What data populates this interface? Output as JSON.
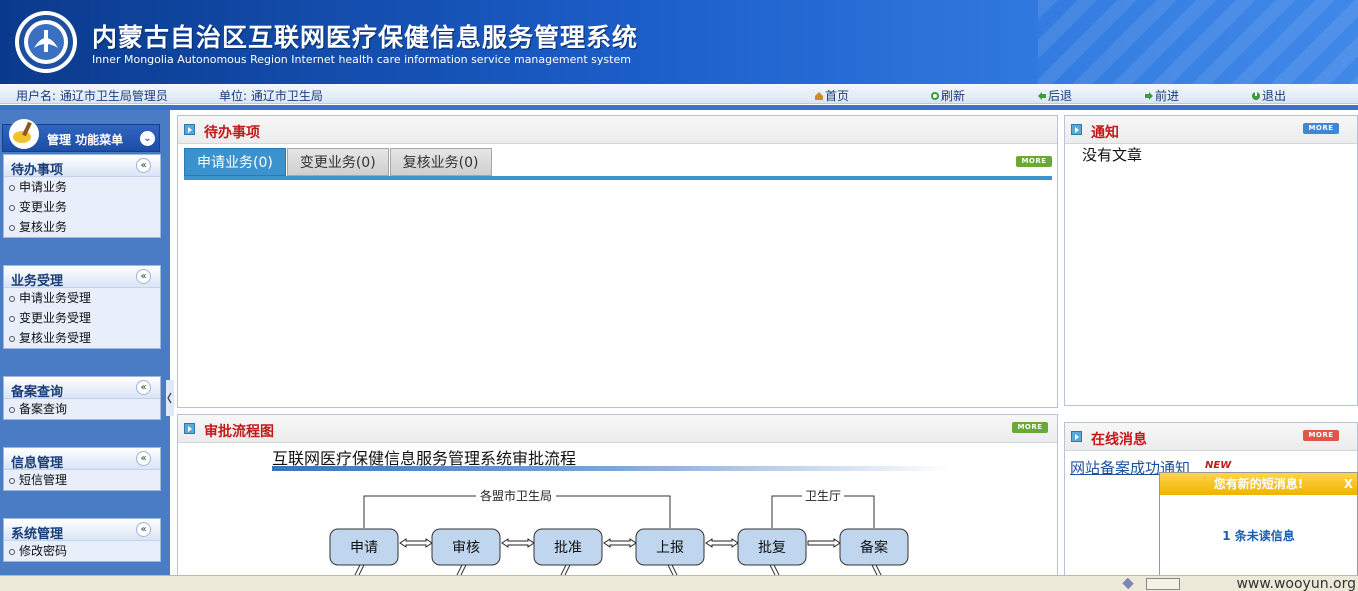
{
  "header": {
    "title_cn": "内蒙古自治区互联网医疗保健信息服务管理系统",
    "title_en": "Inner Mongolia Autonomous Region Internet health care information service management system",
    "logo_icon": "emblem-icon"
  },
  "infobar": {
    "user_label": "用户名: 通辽市卫生局管理员",
    "unit_label": "单位: 通辽市卫生局",
    "nav": [
      {
        "label": "首页",
        "icon": "home-icon"
      },
      {
        "label": "刷新",
        "icon": "refresh-icon"
      },
      {
        "label": "后退",
        "icon": "back-arrow-icon"
      },
      {
        "label": "前进",
        "icon": "forward-arrow-icon"
      },
      {
        "label": "退出",
        "icon": "exit-icon"
      }
    ]
  },
  "sidebar": {
    "title": "管理 功能菜单",
    "groups": [
      {
        "title": "待办事项",
        "items": [
          "申请业务",
          "变更业务",
          "复核业务"
        ]
      },
      {
        "title": "业务受理",
        "items": [
          "申请业务受理",
          "变更业务受理",
          "复核业务受理"
        ]
      },
      {
        "title": "备案查询",
        "items": [
          "备案查询"
        ]
      },
      {
        "title": "信息管理",
        "items": [
          "短信管理"
        ]
      },
      {
        "title": "系统管理",
        "items": [
          "修改密码"
        ]
      }
    ]
  },
  "todo_panel": {
    "title": "待办事项",
    "tabs": [
      "申请业务(0)",
      "变更业务(0)",
      "复核业务(0)"
    ],
    "active_tab": 0,
    "more": "MORE"
  },
  "notice_panel": {
    "title": "通知",
    "more": "MORE",
    "empty_text": "没有文章"
  },
  "flow_panel": {
    "title": "审批流程图",
    "more": "MORE",
    "diagram_title": "互联网医疗保健信息服务管理系统审批流程",
    "bracket_left": "各盟市卫生局",
    "bracket_right": "卫生厅",
    "steps": [
      "申请",
      "审核",
      "批准",
      "上报",
      "批复",
      "备案"
    ]
  },
  "online_panel": {
    "title": "在线消息",
    "more": "MORE",
    "link_text": "网站备案成功通知",
    "new_badge": "NEW"
  },
  "popup": {
    "title": "您有新的短消息!",
    "close": "X",
    "message": "1 条未读信息"
  },
  "statusbar": {
    "watermark": "www.wooyun.org"
  },
  "colors": {
    "header_blue": "#1b5cc6",
    "panel_title_red": "#c21a1a",
    "tab_active": "#3a93cf",
    "popup_yellow": "#f1b300"
  }
}
